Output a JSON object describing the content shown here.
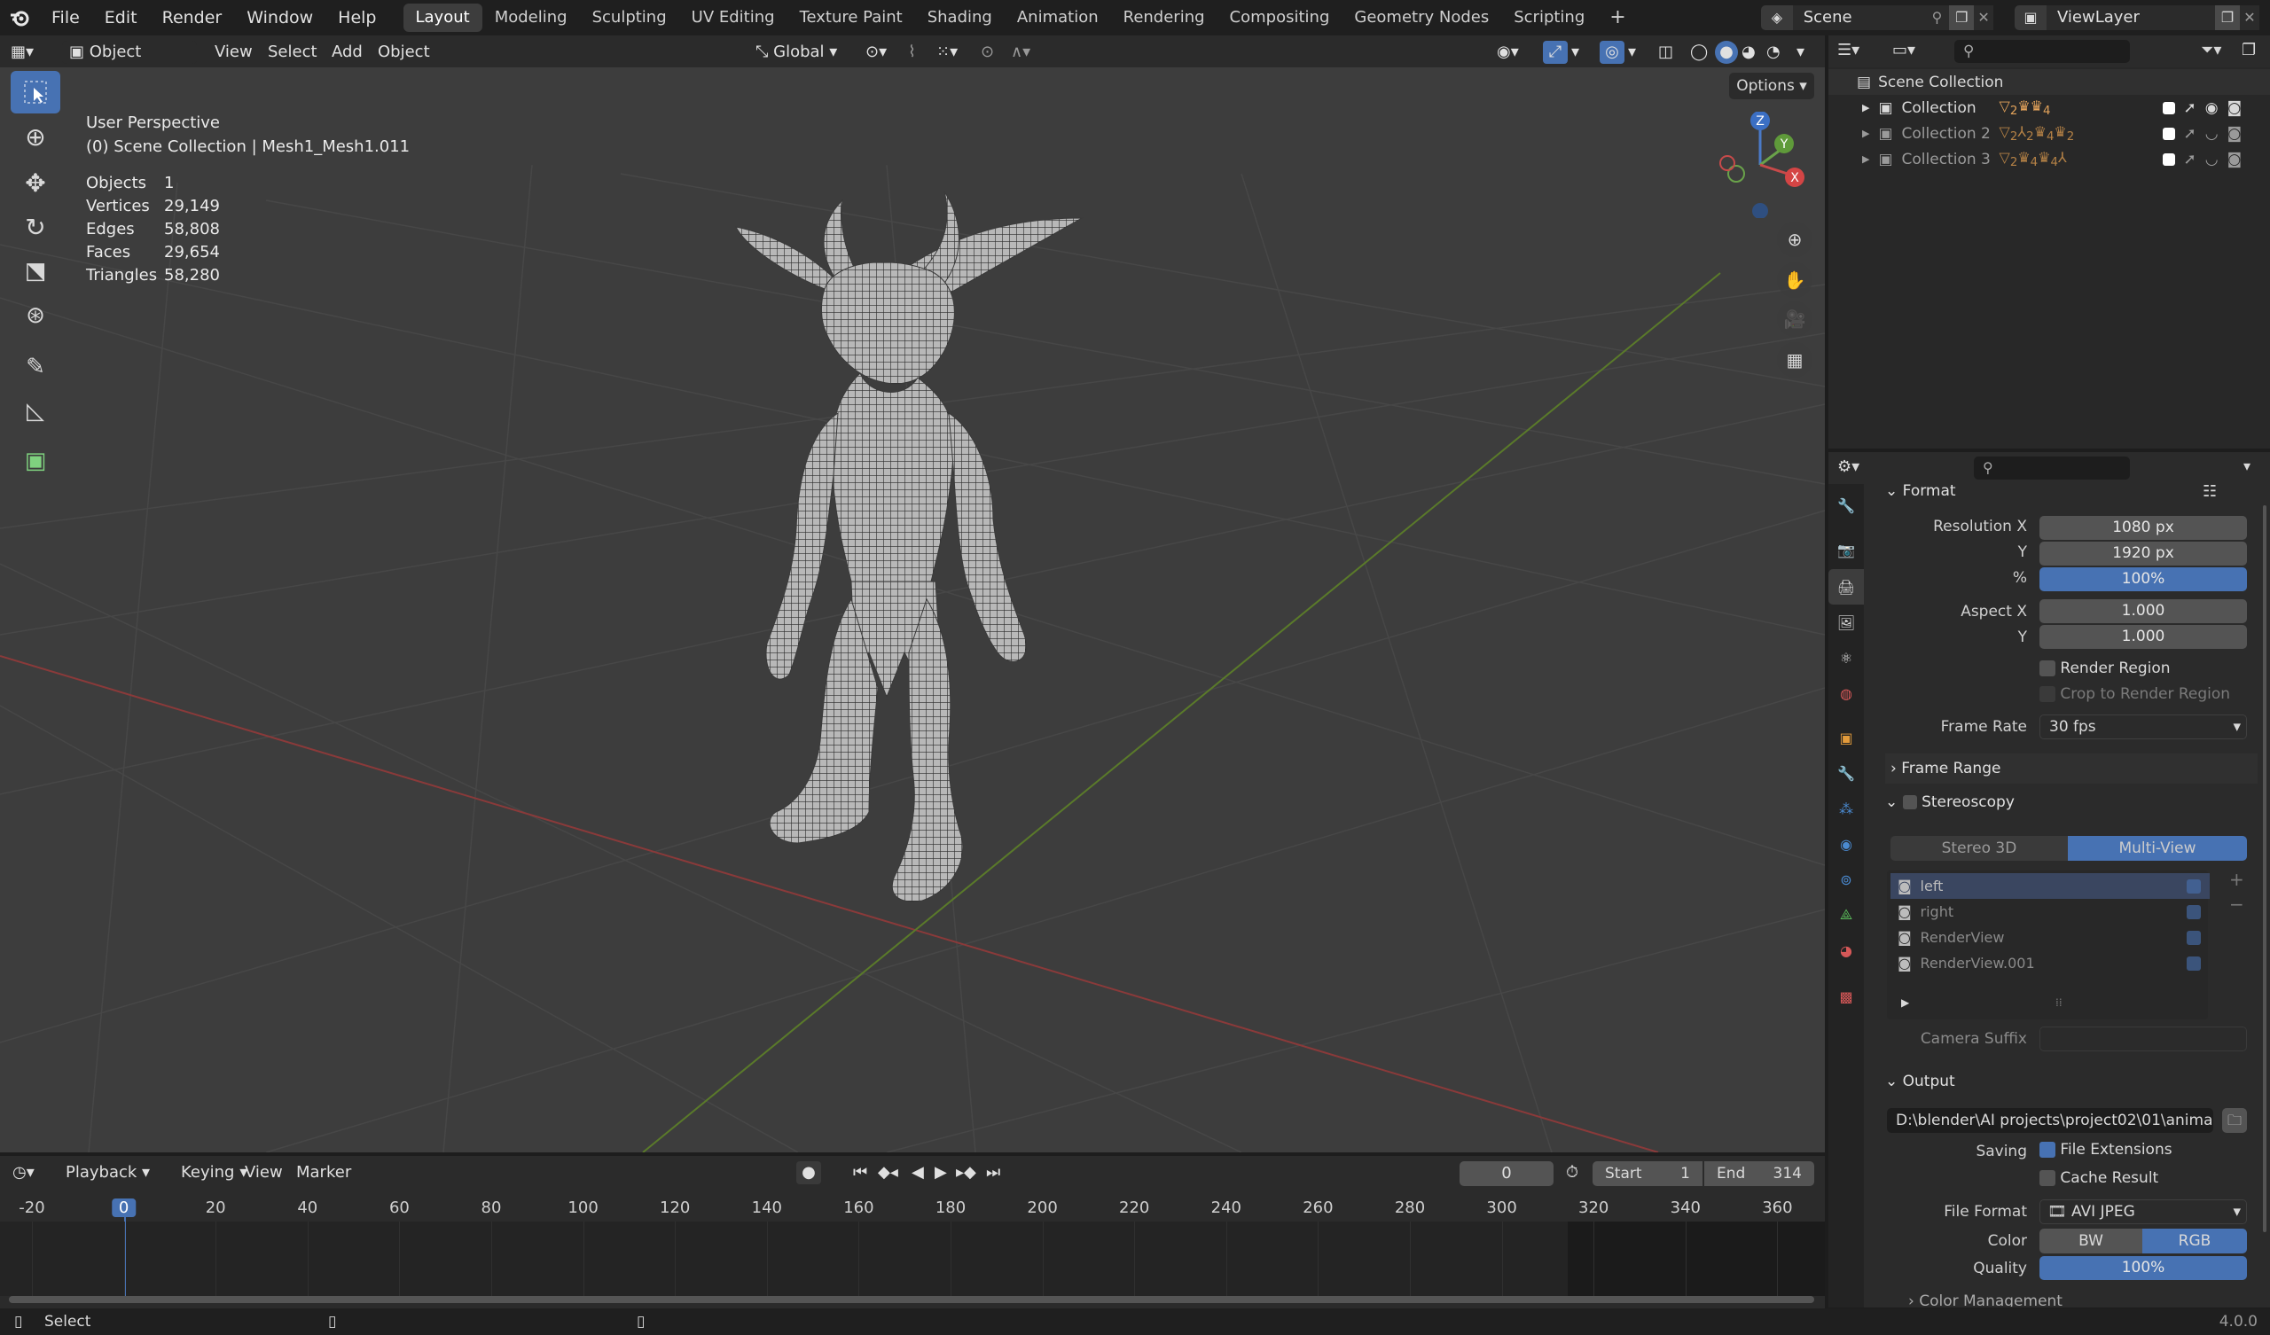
{
  "menu": [
    "File",
    "Edit",
    "Render",
    "Window",
    "Help"
  ],
  "workspaces": [
    "Layout",
    "Modeling",
    "Sculpting",
    "UV Editing",
    "Texture Paint",
    "Shading",
    "Animation",
    "Rendering",
    "Compositing",
    "Geometry Nodes",
    "Scripting"
  ],
  "active_workspace": "Layout",
  "scene_name": "Scene",
  "view_layer": "ViewLayer",
  "viewport_header": {
    "mode": "Object Mode",
    "menus": [
      "View",
      "Select",
      "Add",
      "Object"
    ],
    "orientation": "Global",
    "options": "Options"
  },
  "viewport_info": {
    "title": "User Perspective",
    "context": "(0) Scene Collection | Mesh1_Mesh1.011",
    "stats": [
      {
        "label": "Objects",
        "value": "1"
      },
      {
        "label": "Vertices",
        "value": "29,149"
      },
      {
        "label": "Edges",
        "value": "58,808"
      },
      {
        "label": "Faces",
        "value": "29,654"
      },
      {
        "label": "Triangles",
        "value": "58,280"
      }
    ]
  },
  "gizmo": {
    "z": "Z",
    "y": "Y",
    "x": "X"
  },
  "outliner": {
    "root": "Scene Collection",
    "collections": [
      {
        "name": "Collection",
        "counts": [
          "2",
          "4"
        ]
      },
      {
        "name": "Collection 2",
        "counts": [
          "2",
          "2",
          "4",
          "2"
        ]
      },
      {
        "name": "Collection 3",
        "counts": [
          "2",
          "4",
          "4"
        ]
      }
    ]
  },
  "properties": {
    "format": {
      "title": "Format",
      "resolution_x_label": "Resolution X",
      "resolution_x": "1080 px",
      "y_label": "Y",
      "resolution_y": "1920 px",
      "pct_label": "%",
      "resolution_pct": "100%",
      "aspect_x_label": "Aspect X",
      "aspect_x": "1.000",
      "aspect_y_label": "Y",
      "aspect_y": "1.000",
      "render_region": "Render Region",
      "crop_region": "Crop to Render Region",
      "frame_rate_label": "Frame Rate",
      "frame_rate": "30 fps"
    },
    "frame_range": "Frame Range",
    "stereoscopy": {
      "title": "Stereoscopy",
      "mode_a": "Stereo 3D",
      "mode_b": "Multi-View",
      "views": [
        "left",
        "right",
        "RenderView",
        "RenderView.001"
      ],
      "camera_suffix": "Camera Suffix"
    },
    "output": {
      "title": "Output",
      "path": "D:\\blender\\AI projects\\project02\\01\\anima...",
      "saving_label": "Saving",
      "file_extensions": "File Extensions",
      "cache_result": "Cache Result",
      "file_format_label": "File Format",
      "file_format": "AVI JPEG",
      "color_label": "Color",
      "color_bw": "BW",
      "color_rgb": "RGB",
      "quality_label": "Quality",
      "quality": "100%",
      "color_management": "Color Management"
    }
  },
  "timeline": {
    "menus": [
      "Playback",
      "Keying",
      "View",
      "Marker"
    ],
    "current_frame": "0",
    "start_label": "Start",
    "start": "1",
    "end_label": "End",
    "end": "314",
    "ticks": [
      "-20",
      "0",
      "20",
      "40",
      "60",
      "80",
      "100",
      "120",
      "140",
      "160",
      "180",
      "200",
      "220",
      "240",
      "260",
      "280",
      "300",
      "320",
      "340",
      "360"
    ]
  },
  "status": {
    "left": "Select",
    "version": "4.0.0"
  }
}
